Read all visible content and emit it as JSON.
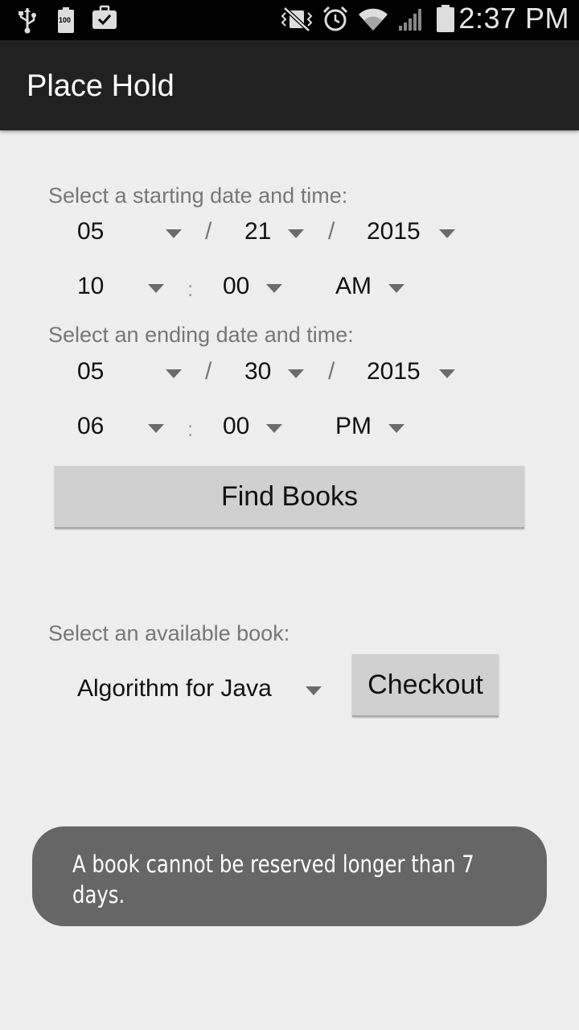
{
  "status_bar": {
    "time": "2:37 PM",
    "battery_small_label": "100",
    "icons": [
      "usb-icon",
      "battery-100-icon",
      "briefcase-check-icon",
      "vibrate-mute-icon",
      "alarm-icon",
      "wifi-icon",
      "signal-icon",
      "battery-icon"
    ]
  },
  "action_bar": {
    "title": "Place Hold"
  },
  "start": {
    "label": "Select a starting date and time:",
    "month": "05",
    "day": "21",
    "year": "2015",
    "hour": "10",
    "minute": "00",
    "ampm": "AM"
  },
  "end": {
    "label": "Select an ending date and time:",
    "month": "05",
    "day": "30",
    "year": "2015",
    "hour": "06",
    "minute": "00",
    "ampm": "PM"
  },
  "separators": {
    "date": "/",
    "time": ":"
  },
  "find_button": {
    "label": "Find Books"
  },
  "book": {
    "label": "Select an available book:",
    "selected": "Algorithm for Java",
    "checkout_label": "Checkout"
  },
  "toast": {
    "message": "A book cannot be reserved longer than 7 days."
  }
}
